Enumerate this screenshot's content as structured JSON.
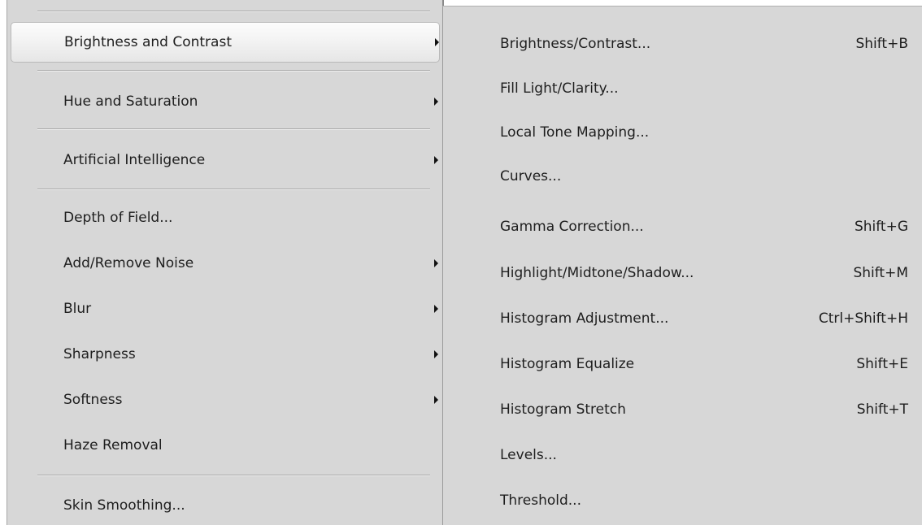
{
  "main_menu": {
    "items": [
      {
        "label": "Brightness and Contrast",
        "has_submenu": true,
        "highlighted": true
      },
      {
        "label": "Hue and Saturation",
        "has_submenu": true
      },
      {
        "label": "Artificial Intelligence",
        "has_submenu": true
      },
      {
        "label": "Depth of Field...",
        "has_submenu": false
      },
      {
        "label": "Add/Remove Noise",
        "has_submenu": true
      },
      {
        "label": "Blur",
        "has_submenu": true
      },
      {
        "label": "Sharpness",
        "has_submenu": true
      },
      {
        "label": "Softness",
        "has_submenu": true
      },
      {
        "label": "Haze Removal",
        "has_submenu": false
      },
      {
        "label": "Skin Smoothing...",
        "has_submenu": false
      }
    ]
  },
  "submenu": {
    "items": [
      {
        "label": "Brightness/Contrast...",
        "shortcut": "Shift+B"
      },
      {
        "label": "Fill Light/Clarity...",
        "shortcut": ""
      },
      {
        "label": "Local Tone Mapping...",
        "shortcut": ""
      },
      {
        "label": "Curves...",
        "shortcut": ""
      },
      {
        "label": "Gamma Correction...",
        "shortcut": "Shift+G"
      },
      {
        "label": "Highlight/Midtone/Shadow...",
        "shortcut": "Shift+M"
      },
      {
        "label": "Histogram Adjustment...",
        "shortcut": "Ctrl+Shift+H"
      },
      {
        "label": "Histogram Equalize",
        "shortcut": "Shift+E"
      },
      {
        "label": "Histogram Stretch",
        "shortcut": "Shift+T"
      },
      {
        "label": "Levels...",
        "shortcut": ""
      },
      {
        "label": "Threshold...",
        "shortcut": ""
      }
    ]
  },
  "colors": {
    "menu_background": "#d7d7d7",
    "highlight_background": "#f3f3f3",
    "text": "#1e1e1e",
    "separator": "#a8a8a8"
  },
  "icons": {
    "submenu_arrow": "chevron-right-icon"
  }
}
